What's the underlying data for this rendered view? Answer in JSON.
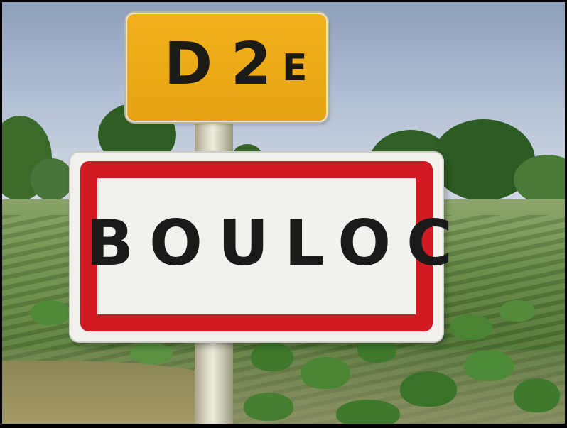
{
  "route_sign": {
    "letter_d": "D",
    "number": "2",
    "suffix": "E",
    "color": "#f2b21a"
  },
  "town_sign": {
    "name": "BOULOC",
    "border_color": "#d11a22",
    "background_color": "#f2f1ee"
  }
}
